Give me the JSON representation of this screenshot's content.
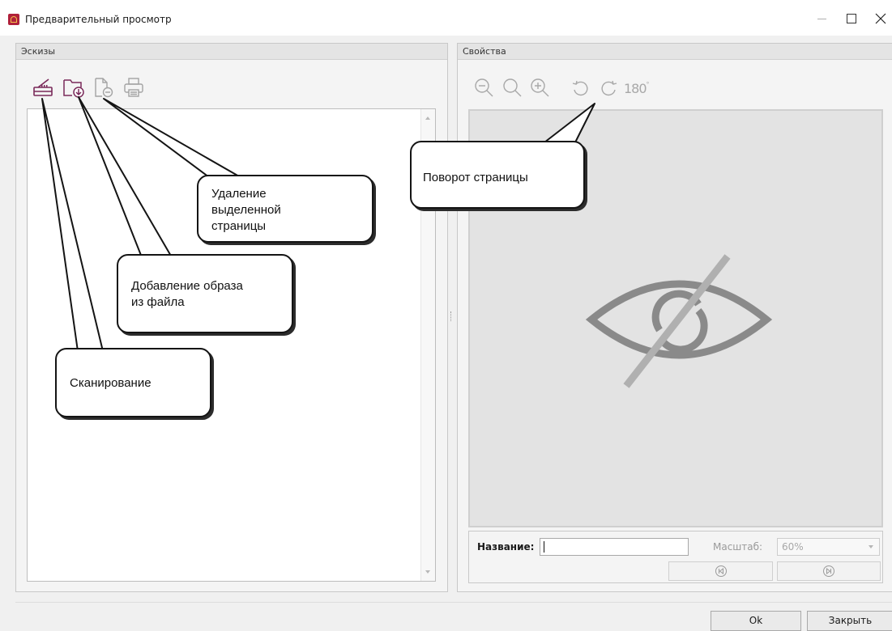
{
  "window": {
    "title": "Предварительный просмотр",
    "icon": "app-logo-icon",
    "controls": [
      "minimize-icon",
      "maximize-icon",
      "close-icon"
    ]
  },
  "left_panel": {
    "title": "Эскизы",
    "toolbar": [
      "scan-icon",
      "add-from-file-icon",
      "delete-page-icon",
      "print-icon"
    ]
  },
  "right_panel": {
    "title": "Свойства",
    "toolbar": [
      "zoom-out-icon",
      "zoom-fit-icon",
      "zoom-in-icon",
      "rotate-left-icon",
      "rotate-right-icon"
    ],
    "rotate_180_label": "180",
    "preview_icon": "eye-crossed-icon",
    "name_label": "Название:",
    "name_value": "",
    "scale_label": "Масштаб:",
    "scale_value": "60%",
    "nav": [
      "first-page-icon",
      "last-page-icon"
    ]
  },
  "buttons": {
    "ok": "Ok",
    "close": "Закрыть"
  },
  "callouts": {
    "delete": [
      "Удаление",
      "выделенной",
      "страницы"
    ],
    "rotate": "Поворот страницы",
    "add": [
      "Добавление образа",
      "из файла"
    ],
    "scan": "Сканирование"
  },
  "colors": {
    "accent": "#7a2a5a",
    "callout_border": "#141414",
    "preview_bg": "#e3e3e3"
  }
}
